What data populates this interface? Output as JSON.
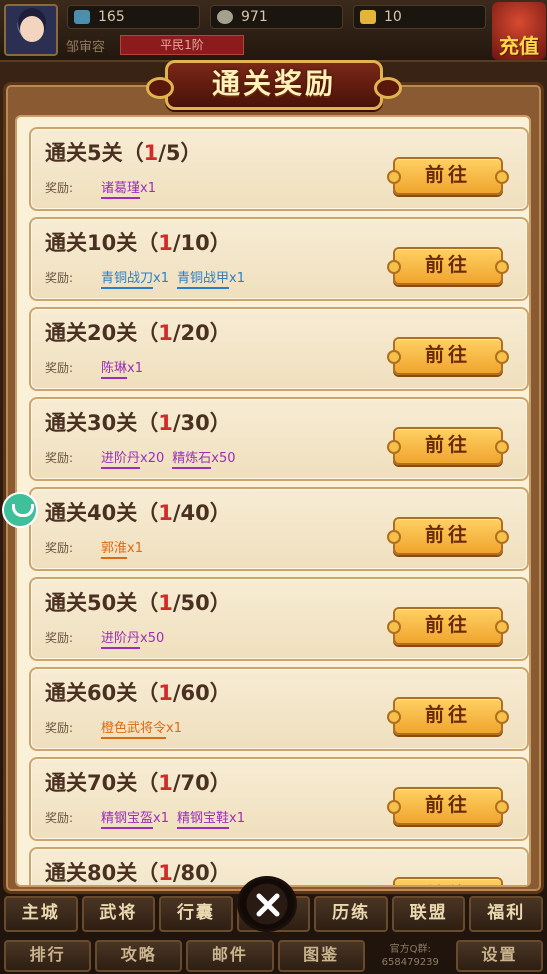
{
  "resources": {
    "jade": "165",
    "copper": "971",
    "gold": "10"
  },
  "player": {
    "name": "邹审容",
    "rank": "平民1阶"
  },
  "recharge_label": "充值",
  "dialog": {
    "title": "通关奖励",
    "reward_label": "奖励:",
    "go_label": "前往",
    "cards": [
      {
        "stage": "通关5关",
        "progress_open": "（",
        "current": "1",
        "total": "/5）",
        "items": [
          {
            "name": "诸葛瑾",
            "qty": "x1",
            "color": "purple"
          }
        ]
      },
      {
        "stage": "通关10关",
        "progress_open": "（",
        "current": "1",
        "total": "/10）",
        "items": [
          {
            "name": "青铜战刀",
            "qty": "x1",
            "color": "blue"
          },
          {
            "name": "青铜战甲",
            "qty": "x1",
            "color": "blue"
          }
        ]
      },
      {
        "stage": "通关20关",
        "progress_open": "（",
        "current": "1",
        "total": "/20）",
        "items": [
          {
            "name": "陈琳",
            "qty": "x1",
            "color": "purple"
          }
        ]
      },
      {
        "stage": "通关30关",
        "progress_open": "（",
        "current": "1",
        "total": "/30）",
        "items": [
          {
            "name": "进阶丹",
            "qty": "x20",
            "color": "purple"
          },
          {
            "name": "精炼石",
            "qty": "x50",
            "color": "purple"
          }
        ]
      },
      {
        "stage": "通关40关",
        "progress_open": "（",
        "current": "1",
        "total": "/40）",
        "items": [
          {
            "name": "郭淮",
            "qty": "x1",
            "color": "orange"
          }
        ]
      },
      {
        "stage": "通关50关",
        "progress_open": "（",
        "current": "1",
        "total": "/50）",
        "items": [
          {
            "name": "进阶丹",
            "qty": "x50",
            "color": "purple"
          }
        ]
      },
      {
        "stage": "通关60关",
        "progress_open": "（",
        "current": "1",
        "total": "/60）",
        "items": [
          {
            "name": "橙色武将令",
            "qty": "x1",
            "color": "orange"
          }
        ]
      },
      {
        "stage": "通关70关",
        "progress_open": "（",
        "current": "1",
        "total": "/70）",
        "items": [
          {
            "name": "精钢宝盔",
            "qty": "x1",
            "color": "purple"
          },
          {
            "name": "精钢宝鞋",
            "qty": "x1",
            "color": "purple"
          }
        ]
      },
      {
        "stage": "通关80关",
        "progress_open": "（",
        "current": "1",
        "total": "/80）",
        "items": []
      }
    ]
  },
  "nav_main": [
    "主城",
    "武将",
    "行囊",
    "",
    "历练",
    "联盟",
    "福利"
  ],
  "nav_sub": [
    "排行",
    "攻略",
    "邮件",
    "图鉴"
  ],
  "qq_group": {
    "line1": "官方Q群:",
    "line2": "658479239"
  },
  "nav_settings": "设置",
  "colors": {
    "purple": "#9b2fb8",
    "blue": "#2b7fc8",
    "orange": "#dc6a14",
    "progress_current": "#d02a2a"
  }
}
